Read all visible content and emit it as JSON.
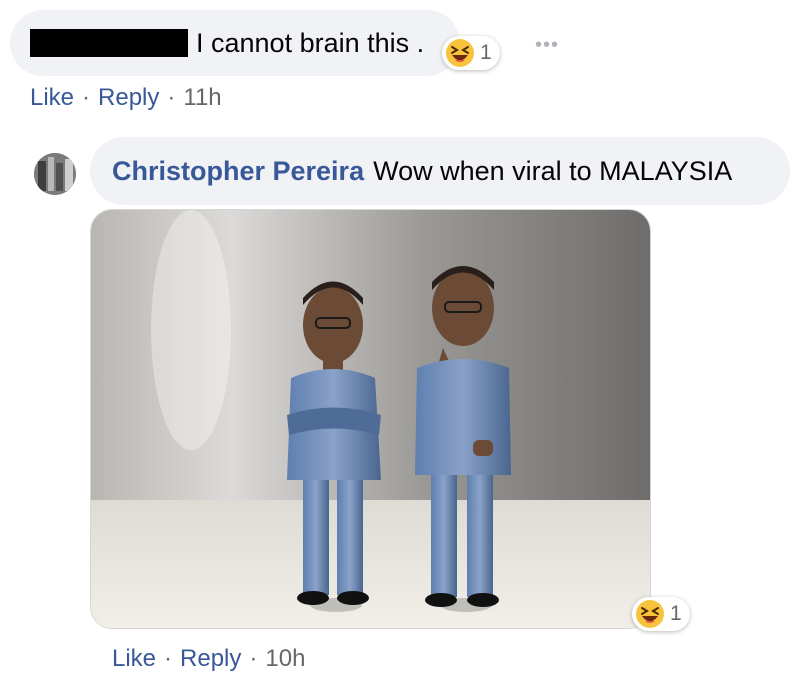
{
  "comment1": {
    "text": "I cannot brain this .",
    "reaction": {
      "icon": "laughing-emoji-icon",
      "count": "1"
    },
    "actions": {
      "like": "Like",
      "reply": "Reply",
      "time": "11h"
    },
    "more_icon": "more-options-icon"
  },
  "comment2": {
    "author": "Christopher Pereira",
    "text": "Wow when viral to MALAYSIA",
    "reaction": {
      "icon": "laughing-emoji-icon",
      "count": "1"
    },
    "actions": {
      "like": "Like",
      "reply": "Reply",
      "time": "10h"
    }
  },
  "colors": {
    "link": "#385898",
    "bubble": "#f0f2f5",
    "meta": "#65676b",
    "emoji": "#f7c33d"
  }
}
